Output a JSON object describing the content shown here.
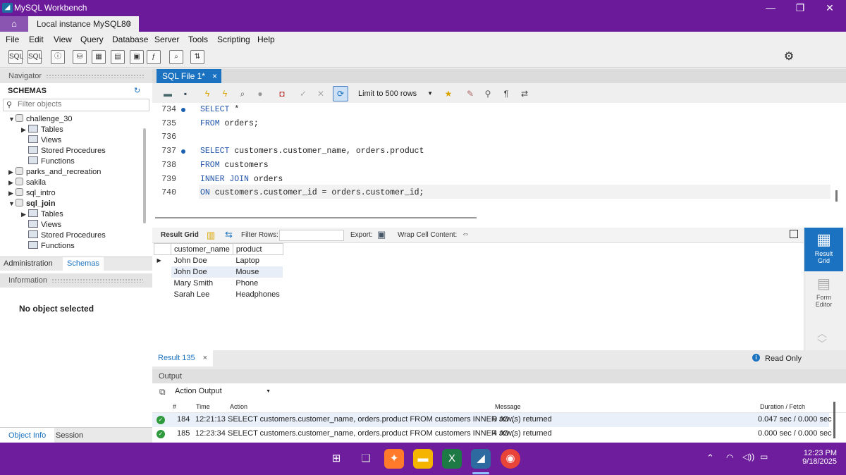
{
  "window": {
    "title": "MySQL Workbench",
    "tab": "Local instance MySQL80",
    "tab_close": "×"
  },
  "menu": [
    "File",
    "Edit",
    "View",
    "Query",
    "Database",
    "Server",
    "Tools",
    "Scripting",
    "Help"
  ],
  "navigator": {
    "title": "Navigator",
    "schemas_label": "SCHEMAS",
    "filter_placeholder": "Filter objects",
    "tree": [
      {
        "label": "challenge_30",
        "level": 0,
        "type": "db",
        "expanded": true,
        "bold": false
      },
      {
        "label": "Tables",
        "level": 1,
        "type": "folder",
        "expanded": false
      },
      {
        "label": "Views",
        "level": 1,
        "type": "folder"
      },
      {
        "label": "Stored Procedures",
        "level": 1,
        "type": "folder"
      },
      {
        "label": "Functions",
        "level": 1,
        "type": "folder"
      },
      {
        "label": "parks_and_recreation",
        "level": 0,
        "type": "db",
        "expanded": false
      },
      {
        "label": "sakila",
        "level": 0,
        "type": "db",
        "expanded": false
      },
      {
        "label": "sql_intro",
        "level": 0,
        "type": "db",
        "expanded": false
      },
      {
        "label": "sql_join",
        "level": 0,
        "type": "db",
        "expanded": true,
        "bold": true
      },
      {
        "label": "Tables",
        "level": 1,
        "type": "folder",
        "expanded": false
      },
      {
        "label": "Views",
        "level": 1,
        "type": "folder"
      },
      {
        "label": "Stored Procedures",
        "level": 1,
        "type": "folder"
      },
      {
        "label": "Functions",
        "level": 1,
        "type": "folder"
      }
    ],
    "tabs": [
      "Administration",
      "Schemas"
    ],
    "information_title": "Information",
    "no_object": "No object selected",
    "bottom_tabs": [
      "Object Info",
      "Session"
    ]
  },
  "editor": {
    "tab": "SQL File 1*",
    "tab_close": "×",
    "limit": "Limit to 500 rows",
    "lines": [
      {
        "n": "734",
        "dot": true,
        "text": "SELECT *"
      },
      {
        "n": "735",
        "dot": false,
        "text": "FROM orders;"
      },
      {
        "n": "736",
        "dot": false,
        "text": ""
      },
      {
        "n": "737",
        "dot": true,
        "text": "SELECT customers.customer_name, orders.product"
      },
      {
        "n": "738",
        "dot": false,
        "text": "FROM customers"
      },
      {
        "n": "739",
        "dot": false,
        "text": "INNER JOIN orders"
      },
      {
        "n": "740",
        "dot": false,
        "text": "ON customers.customer_id = orders.customer_id;"
      }
    ]
  },
  "result": {
    "result_grid": "Result Grid",
    "filter_rows": "Filter Rows:",
    "export": "Export:",
    "wrap": "Wrap Cell Content:",
    "columns": [
      "customer_name",
      "product"
    ],
    "rows": [
      [
        "John Doe",
        "Laptop"
      ],
      [
        "John Doe",
        "Mouse"
      ],
      [
        "Mary Smith",
        "Phone"
      ],
      [
        "Sarah Lee",
        "Headphones"
      ]
    ],
    "tab": "Result 135",
    "tab_close": "×",
    "read_only": "Read Only",
    "side": {
      "result_grid": "Result Grid",
      "form_editor": "Form Editor"
    }
  },
  "output": {
    "title": "Output",
    "selector": "Action Output",
    "columns": [
      "#",
      "Time",
      "Action",
      "Message",
      "Duration / Fetch"
    ],
    "rows": [
      {
        "num": "184",
        "time": "12:21:13",
        "action": "SELECT customers.customer_name, orders.product FROM customers INNER JO...",
        "message": "0 row(s) returned",
        "duration": "0.047 sec / 0.000 sec"
      },
      {
        "num": "185",
        "time": "12:23:34",
        "action": "SELECT customers.customer_name, orders.product FROM customers INNER JO...",
        "message": "4 row(s) returned",
        "duration": "0.000 sec / 0.000 sec"
      }
    ]
  },
  "taskbar": {
    "time": "12:23 PM",
    "date": "9/18/2025"
  },
  "colors": {
    "titlebar": "#6b1a9a",
    "accent": "#1a72c0",
    "taskbar": "#6e1d9c"
  }
}
